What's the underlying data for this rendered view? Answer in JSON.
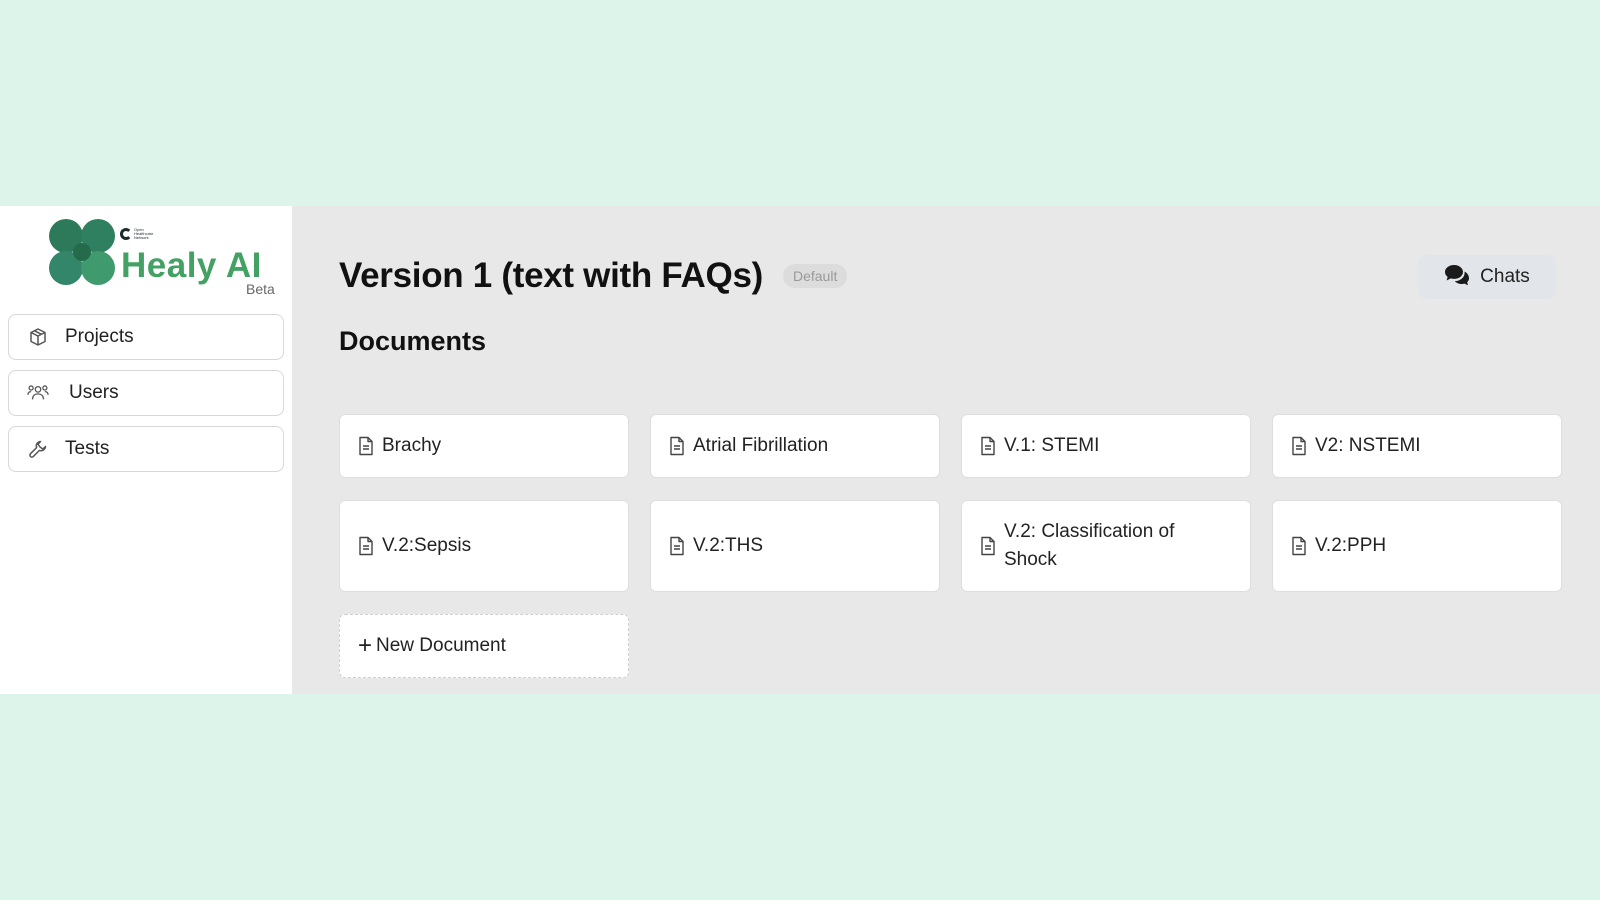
{
  "brand": {
    "org_name": "Open Healthcare Network",
    "name": "Healy AI",
    "badge": "Beta"
  },
  "sidebar": {
    "items": [
      {
        "label": "Projects",
        "icon": "cube-icon"
      },
      {
        "label": "Users",
        "icon": "users-icon"
      },
      {
        "label": "Tests",
        "icon": "wrench-icon"
      }
    ]
  },
  "header": {
    "title": "Version 1 (text with FAQs)",
    "badge": "Default",
    "chats_label": "Chats"
  },
  "documents": {
    "section_title": "Documents",
    "items": [
      {
        "label": "Brachy"
      },
      {
        "label": "Atrial Fibrillation"
      },
      {
        "label": "V.1: STEMI"
      },
      {
        "label": "V2: NSTEMI"
      },
      {
        "label": "V.2:Sepsis"
      },
      {
        "label": "V.2:THS"
      },
      {
        "label": "V.2: Classification of Shock"
      },
      {
        "label": "V.2:PPH"
      }
    ],
    "new_label": "New Document"
  },
  "colors": {
    "background": "#dcf4ea",
    "brand_green": "#43a164",
    "logo_dark": "#2d7a5a",
    "logo_light": "#3f9a6e"
  }
}
